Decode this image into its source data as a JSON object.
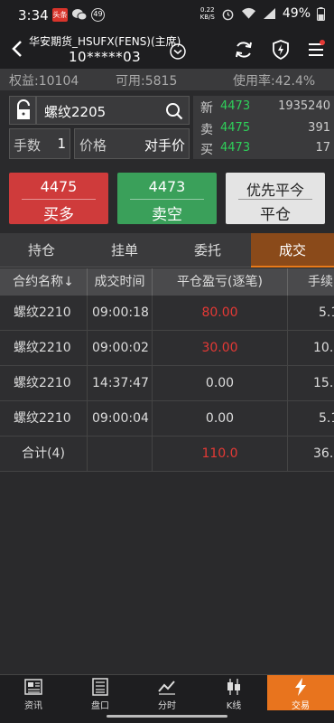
{
  "status": {
    "time": "3:34",
    "badge1": "头条",
    "badge2": "49",
    "speed": "0.22",
    "speed_unit": "KB/S",
    "battery": "49%"
  },
  "header": {
    "account_title": "华安期货_HSUFX(FENS)(主席)",
    "account_num": "10*****03"
  },
  "info": {
    "equity": "权益:10104",
    "available": "可用:5815",
    "usage": "使用率:42.4%"
  },
  "order": {
    "symbol": "螺纹2205",
    "qty_label": "手数",
    "qty_value": "1",
    "price_label": "价格",
    "price_value": "对手价"
  },
  "quote": [
    {
      "key": "新",
      "price": "4473",
      "vol": "1935240"
    },
    {
      "key": "卖",
      "price": "4475",
      "vol": "391"
    },
    {
      "key": "买",
      "price": "4473",
      "vol": "17"
    }
  ],
  "actions": {
    "buy": {
      "price": "4475",
      "label": "买多"
    },
    "sell": {
      "price": "4473",
      "label": "卖空"
    },
    "close": {
      "top": "优先平今",
      "label": "平仓"
    }
  },
  "tabs": [
    "持仓",
    "挂单",
    "委托",
    "成交"
  ],
  "grid": {
    "headers": [
      "合约名称↓",
      "成交时间",
      "平仓盈亏(逐笔)",
      "手续"
    ],
    "rows": [
      {
        "name": "螺纹2210",
        "time": "09:00:18",
        "pnl": "80.00",
        "fee": "5.1"
      },
      {
        "name": "螺纹2210",
        "time": "09:00:02",
        "pnl": "30.00",
        "fee": "10."
      },
      {
        "name": "螺纹2210",
        "time": "14:37:47",
        "pnl": "0.00",
        "fee": "15."
      },
      {
        "name": "螺纹2210",
        "time": "09:00:04",
        "pnl": "0.00",
        "fee": "5.1"
      }
    ],
    "total": {
      "name": "合计(4)",
      "pnl": "110.0",
      "fee": "36."
    }
  },
  "nav": [
    "资讯",
    "盘口",
    "分时",
    "K线",
    "交易"
  ],
  "colors": {
    "accent": "#e8741e",
    "up": "#e53935",
    "down": "#2fcf5a"
  }
}
